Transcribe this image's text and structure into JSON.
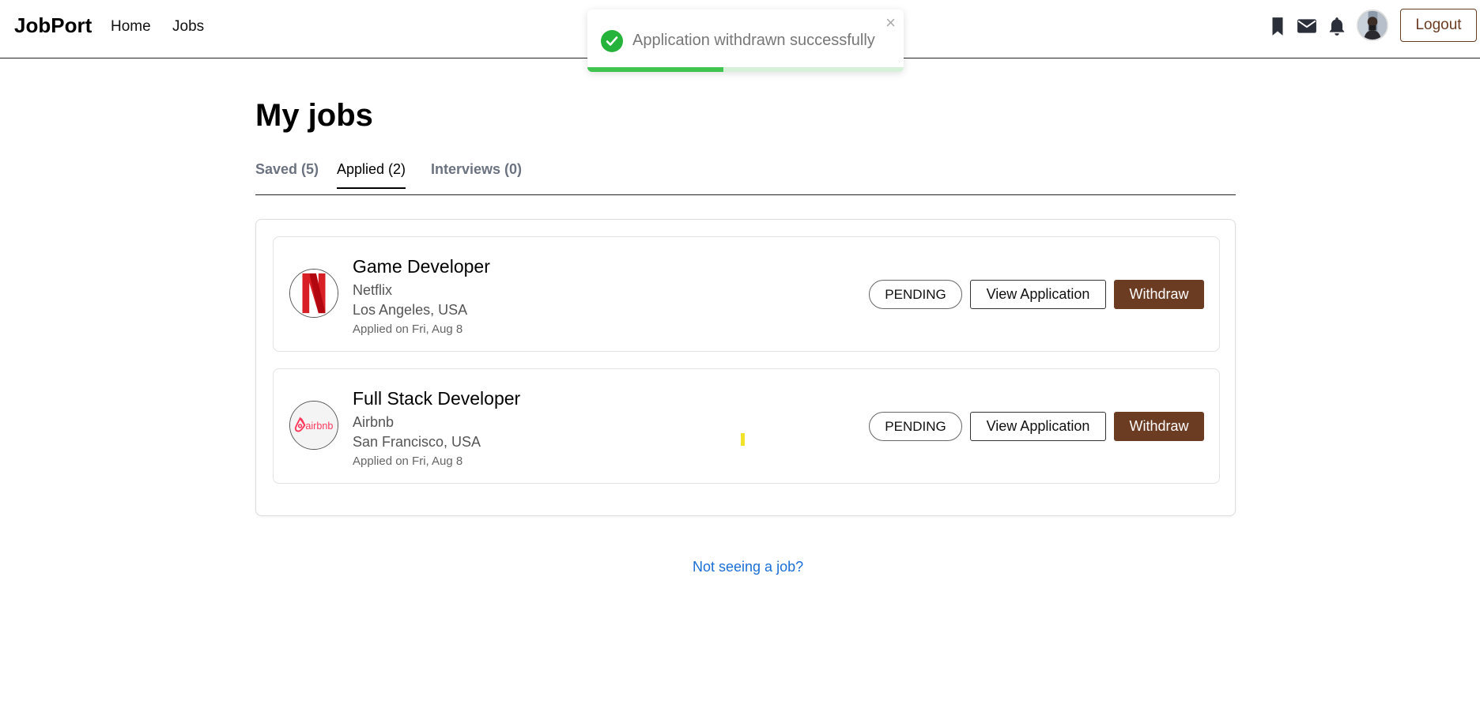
{
  "navbar": {
    "brand": "JobPort",
    "links": [
      "Home",
      "Jobs"
    ],
    "icons": [
      "bookmark-icon",
      "mail-icon",
      "bell-icon"
    ],
    "logout_label": "Logout"
  },
  "toast": {
    "message": "Application withdrawn successfully",
    "close_glyph": "×",
    "progress": 0.43,
    "colors": {
      "success": "#25b33b"
    }
  },
  "page": {
    "title": "My jobs",
    "tabs": [
      {
        "label": "Saved (5)",
        "active": false
      },
      {
        "label": "Applied (2)",
        "active": true
      },
      {
        "label": "Interviews (0)",
        "active": false
      }
    ]
  },
  "jobs": [
    {
      "title": "Game Developer",
      "company": "Netflix",
      "location": "Los Angeles, USA",
      "applied_on": "Applied on Fri, Aug 8",
      "status": "PENDING",
      "view_label": "View Application",
      "withdraw_label": "Withdraw",
      "logo": "N"
    },
    {
      "title": "Full Stack Developer",
      "company": "Airbnb",
      "location": "San Francisco, USA",
      "applied_on": "Applied on Fri, Aug 8",
      "status": "PENDING",
      "view_label": "View Application",
      "withdraw_label": "Withdraw",
      "logo": "airbnb"
    }
  ],
  "footer_link": "Not seeing a job?",
  "colors": {
    "accent": "#6b3b22",
    "link": "#1a6ed8"
  }
}
